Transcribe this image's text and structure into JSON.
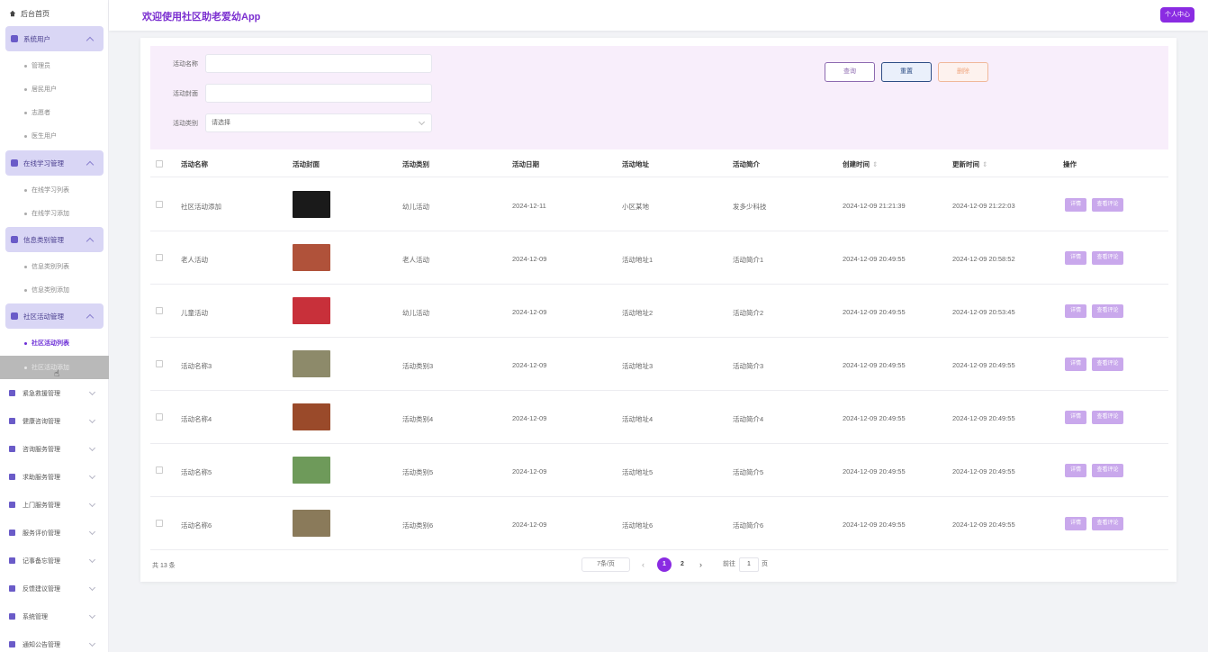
{
  "app": {
    "title": "欢迎使用社区助老爱幼App",
    "user_center": "个人中心"
  },
  "sidebar": {
    "home": "后台首页",
    "expanded": [
      {
        "label": "系统用户",
        "items": [
          "管理员",
          "居民用户",
          "志愿者",
          "医生用户"
        ]
      },
      {
        "label": "在线学习管理",
        "items": [
          "在线学习列表",
          "在线学习添加"
        ]
      },
      {
        "label": "信息类别管理",
        "items": [
          "信息类别列表",
          "信息类别添加"
        ]
      },
      {
        "label": "社区活动管理",
        "items": [
          "社区活动列表",
          "社区活动添加"
        ]
      }
    ],
    "collapsed": [
      "紧急救援管理",
      "健康咨询管理",
      "咨询服务管理",
      "求助服务管理",
      "上门服务管理",
      "服务评价管理",
      "记事备忘管理",
      "反馈建议管理",
      "系统管理",
      "通知公告管理"
    ]
  },
  "search": {
    "name_label": "活动名称",
    "name_value": "",
    "cover_label": "活动封面",
    "cover_value": "",
    "type_label": "活动类别",
    "type_placeholder": "请选择",
    "query_btn": "查询",
    "reset_btn": "重置",
    "delete_btn": "删除"
  },
  "table": {
    "headers": [
      "活动名称",
      "活动封面",
      "活动类别",
      "活动日期",
      "活动地址",
      "活动简介",
      "创建时间",
      "更新时间",
      "操作"
    ],
    "sort_glyph": "⇕",
    "detail_btn": "详情",
    "review_btn": "查看评论",
    "rows": [
      {
        "name": "社区活动添加",
        "type": "幼儿活动",
        "date": "2024-12-11",
        "address": "小区某地",
        "intro": "发多少科技",
        "created": "2024-12-09 21:21:39",
        "updated": "2024-12-09 21:22:03",
        "thumb": "#1a1a1a"
      },
      {
        "name": "老人活动",
        "type": "老人活动",
        "date": "2024-12-09",
        "address": "活动地址1",
        "intro": "活动简介1",
        "created": "2024-12-09 20:49:55",
        "updated": "2024-12-09 20:58:52",
        "thumb": "#b0523a"
      },
      {
        "name": "儿童活动",
        "type": "幼儿活动",
        "date": "2024-12-09",
        "address": "活动地址2",
        "intro": "活动简介2",
        "created": "2024-12-09 20:49:55",
        "updated": "2024-12-09 20:53:45",
        "thumb": "#c8303a"
      },
      {
        "name": "活动名称3",
        "type": "活动类别3",
        "date": "2024-12-09",
        "address": "活动地址3",
        "intro": "活动简介3",
        "created": "2024-12-09 20:49:55",
        "updated": "2024-12-09 20:49:55",
        "thumb": "#8d8a6a"
      },
      {
        "name": "活动名称4",
        "type": "活动类别4",
        "date": "2024-12-09",
        "address": "活动地址4",
        "intro": "活动简介4",
        "created": "2024-12-09 20:49:55",
        "updated": "2024-12-09 20:49:55",
        "thumb": "#9a4a2a"
      },
      {
        "name": "活动名称5",
        "type": "活动类别5",
        "date": "2024-12-09",
        "address": "活动地址5",
        "intro": "活动简介5",
        "created": "2024-12-09 20:49:55",
        "updated": "2024-12-09 20:49:55",
        "thumb": "#6e9a5a"
      },
      {
        "name": "活动名称6",
        "type": "活动类别6",
        "date": "2024-12-09",
        "address": "活动地址6",
        "intro": "活动简介6",
        "created": "2024-12-09 20:49:55",
        "updated": "2024-12-09 20:49:55",
        "thumb": "#8a7a5a"
      }
    ]
  },
  "pagination": {
    "total": "共 13 条",
    "page_size": "7条/页",
    "pages": [
      "1",
      "2"
    ],
    "current": "1",
    "goto_label": "前往",
    "goto_value": "1",
    "page_unit": "页"
  },
  "colors": {
    "accent": "#8a2be2",
    "title": "#7b2fd0",
    "sidebar_group": "#d9d6f5",
    "action_btn": "#c9a8ec"
  }
}
